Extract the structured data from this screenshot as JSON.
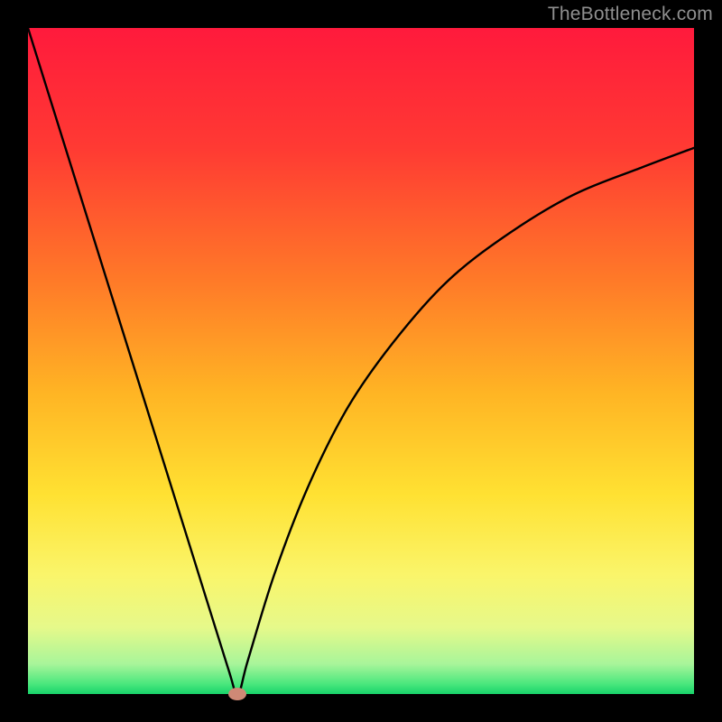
{
  "watermark": "TheBottleneck.com",
  "chart_data": {
    "type": "line",
    "title": "",
    "xlabel": "",
    "ylabel": "",
    "xlim": [
      0,
      100
    ],
    "ylim": [
      0,
      100
    ],
    "series": [
      {
        "name": "bottleneck-curve",
        "x": [
          0,
          5,
          10,
          15,
          20,
          25,
          30,
          31.5,
          33,
          37,
          42,
          48,
          55,
          63,
          72,
          82,
          92,
          100
        ],
        "values": [
          100,
          84,
          68,
          52,
          36,
          20,
          4,
          0,
          5,
          18,
          31,
          43,
          53,
          62,
          69,
          75,
          79,
          82
        ]
      }
    ],
    "minimum_marker": {
      "x": 31.5,
      "y": 0
    },
    "gradient_stops": [
      {
        "pos": 0.0,
        "color": "#ff1a3c"
      },
      {
        "pos": 0.18,
        "color": "#ff3a33"
      },
      {
        "pos": 0.38,
        "color": "#ff7a28"
      },
      {
        "pos": 0.55,
        "color": "#ffb524"
      },
      {
        "pos": 0.7,
        "color": "#ffe132"
      },
      {
        "pos": 0.82,
        "color": "#faf56a"
      },
      {
        "pos": 0.9,
        "color": "#e6f98a"
      },
      {
        "pos": 0.955,
        "color": "#a8f59a"
      },
      {
        "pos": 0.985,
        "color": "#4ae77d"
      },
      {
        "pos": 1.0,
        "color": "#18d36a"
      }
    ]
  }
}
